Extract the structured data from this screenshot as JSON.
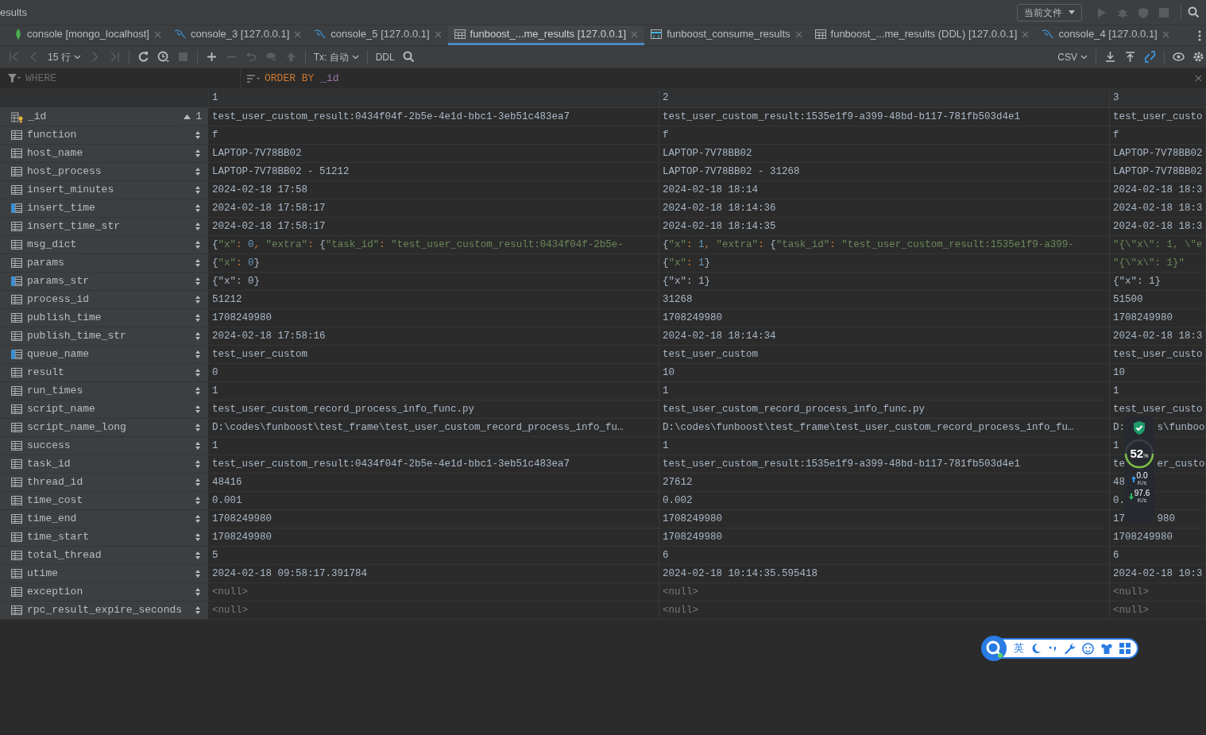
{
  "window": {
    "title": "esults",
    "run_config": "当前文件"
  },
  "tabs": [
    {
      "label": "console [mongo_localhost]",
      "kind": "mongo",
      "selected": false
    },
    {
      "label": "console_3 [127.0.0.1]",
      "kind": "mysql",
      "selected": false
    },
    {
      "label": "console_5 [127.0.0.1]",
      "kind": "mysql",
      "selected": false
    },
    {
      "label": "funboost_...me_results [127.0.0.1]",
      "kind": "table",
      "selected": true
    },
    {
      "label": "funboost_consume_results",
      "kind": "view",
      "selected": false
    },
    {
      "label": "funboost_...me_results (DDL) [127.0.0.1]",
      "kind": "table",
      "selected": false
    },
    {
      "label": "console_4 [127.0.0.1]",
      "kind": "mysql",
      "selected": false
    }
  ],
  "toolbar": {
    "page_size": "15 行",
    "tx": "Tx: 自动",
    "ddl": "DDL",
    "export": "CSV"
  },
  "filter": {
    "where_placeholder": "WHERE",
    "order_keyword": "ORDER BY",
    "order_column": "_id"
  },
  "columns": [
    "1",
    "2",
    "3"
  ],
  "rows": [
    {
      "name": "_id",
      "primary_key": true,
      "indexed": false,
      "sorted": true,
      "sort_order": "1",
      "kind": "text",
      "cells": [
        "test_user_custom_result:0434f04f-2b5e-4e1d-bbc1-3eb51c483ea7",
        "test_user_custom_result:1535e1f9-a399-48bd-b117-781fb503d4e1",
        "test_user_custo"
      ]
    },
    {
      "name": "function",
      "primary_key": false,
      "indexed": false,
      "sorted": false,
      "kind": "text",
      "cells": [
        "f",
        "f",
        "f"
      ]
    },
    {
      "name": "host_name",
      "primary_key": false,
      "indexed": false,
      "sorted": false,
      "kind": "text",
      "cells": [
        "LAPTOP-7V78BB02",
        "LAPTOP-7V78BB02",
        "LAPTOP-7V78BB02"
      ]
    },
    {
      "name": "host_process",
      "primary_key": false,
      "indexed": false,
      "sorted": false,
      "kind": "text",
      "cells": [
        "LAPTOP-7V78BB02 - 51212",
        "LAPTOP-7V78BB02 - 31268",
        "LAPTOP-7V78BB02"
      ]
    },
    {
      "name": "insert_minutes",
      "primary_key": false,
      "indexed": false,
      "sorted": false,
      "kind": "text",
      "cells": [
        "2024-02-18 17:58",
        "2024-02-18 18:14",
        "2024-02-18 18:3"
      ]
    },
    {
      "name": "insert_time",
      "primary_key": false,
      "indexed": true,
      "sorted": false,
      "kind": "text",
      "cells": [
        "2024-02-18 17:58:17",
        "2024-02-18 18:14:36",
        "2024-02-18 18:3"
      ]
    },
    {
      "name": "insert_time_str",
      "primary_key": false,
      "indexed": false,
      "sorted": false,
      "kind": "text",
      "cells": [
        "2024-02-18 17:58:17",
        "2024-02-18 18:14:35",
        "2024-02-18 18:3"
      ]
    },
    {
      "name": "msg_dict",
      "primary_key": false,
      "indexed": false,
      "sorted": false,
      "kind": "json",
      "cells": [
        "{\"x\": 0, \"extra\": {\"task_id\": \"test_user_custom_result:0434f04f-2b5e-",
        "{\"x\": 1, \"extra\": {\"task_id\": \"test_user_custom_result:1535e1f9-a399-",
        "\"{\\\"x\\\": 1, \\\"e"
      ]
    },
    {
      "name": "params",
      "primary_key": false,
      "indexed": false,
      "sorted": false,
      "kind": "json",
      "cells": [
        "{\"x\": 0}",
        "{\"x\": 1}",
        "\"{\\\"x\\\": 1}\""
      ]
    },
    {
      "name": "params_str",
      "primary_key": false,
      "indexed": true,
      "sorted": false,
      "kind": "text",
      "cells": [
        "{\"x\": 0}",
        "{\"x\": 1}",
        "{\"x\": 1}"
      ]
    },
    {
      "name": "process_id",
      "primary_key": false,
      "indexed": false,
      "sorted": false,
      "kind": "text",
      "cells": [
        "51212",
        "31268",
        "51500"
      ]
    },
    {
      "name": "publish_time",
      "primary_key": false,
      "indexed": false,
      "sorted": false,
      "kind": "text",
      "cells": [
        "1708249980",
        "1708249980",
        "1708249980"
      ]
    },
    {
      "name": "publish_time_str",
      "primary_key": false,
      "indexed": false,
      "sorted": false,
      "kind": "text",
      "cells": [
        "2024-02-18 17:58:16",
        "2024-02-18 18:14:34",
        "2024-02-18 18:3"
      ]
    },
    {
      "name": "queue_name",
      "primary_key": false,
      "indexed": true,
      "sorted": false,
      "kind": "text",
      "cells": [
        "test_user_custom",
        "test_user_custom",
        "test_user_custo"
      ]
    },
    {
      "name": "result",
      "primary_key": false,
      "indexed": false,
      "sorted": false,
      "kind": "text",
      "cells": [
        "0",
        "10",
        "10"
      ]
    },
    {
      "name": "run_times",
      "primary_key": false,
      "indexed": false,
      "sorted": false,
      "kind": "text",
      "cells": [
        "1",
        "1",
        "1"
      ]
    },
    {
      "name": "script_name",
      "primary_key": false,
      "indexed": false,
      "sorted": false,
      "kind": "text",
      "cells": [
        "test_user_custom_record_process_info_func.py",
        "test_user_custom_record_process_info_func.py",
        "test_user_custo"
      ]
    },
    {
      "name": "script_name_long",
      "primary_key": false,
      "indexed": false,
      "sorted": false,
      "kind": "text",
      "cells": [
        "D:\\codes\\funboost\\test_frame\\test_user_custom_record_process_info_fu…",
        "D:\\codes\\funboost\\test_frame\\test_user_custom_record_process_info_fu…",
        [
          "D:",
          "s\\funboo"
        ]
      ]
    },
    {
      "name": "success",
      "primary_key": false,
      "indexed": false,
      "sorted": false,
      "kind": "text",
      "cells": [
        "1",
        "1",
        "1"
      ]
    },
    {
      "name": "task_id",
      "primary_key": false,
      "indexed": false,
      "sorted": false,
      "kind": "text",
      "cells": [
        "test_user_custom_result:0434f04f-2b5e-4e1d-bbc1-3eb51c483ea7",
        "test_user_custom_result:1535e1f9-a399-48bd-b117-781fb503d4e1",
        [
          "te",
          "er_custo"
        ]
      ]
    },
    {
      "name": "thread_id",
      "primary_key": false,
      "indexed": false,
      "sorted": false,
      "kind": "text",
      "cells": [
        "48416",
        "27612",
        [
          "48"
        ]
      ]
    },
    {
      "name": "time_cost",
      "primary_key": false,
      "indexed": false,
      "sorted": false,
      "kind": "text",
      "cells": [
        "0.001",
        "0.002",
        [
          "0."
        ]
      ]
    },
    {
      "name": "time_end",
      "primary_key": false,
      "indexed": false,
      "sorted": false,
      "kind": "text",
      "cells": [
        "1708249980",
        "1708249980",
        [
          "17",
          "980"
        ]
      ]
    },
    {
      "name": "time_start",
      "primary_key": false,
      "indexed": false,
      "sorted": false,
      "kind": "text",
      "cells": [
        "1708249980",
        "1708249980",
        "1708249980"
      ]
    },
    {
      "name": "total_thread",
      "primary_key": false,
      "indexed": false,
      "sorted": false,
      "kind": "text",
      "cells": [
        "5",
        "6",
        "6"
      ]
    },
    {
      "name": "utime",
      "primary_key": false,
      "indexed": false,
      "sorted": false,
      "kind": "text",
      "cells": [
        "2024-02-18 09:58:17.391784",
        "2024-02-18 10:14:35.595418",
        "2024-02-18 10:3"
      ]
    },
    {
      "name": "exception",
      "primary_key": false,
      "indexed": false,
      "sorted": false,
      "kind": "null",
      "cells": [
        "<null>",
        "<null>",
        "<null>"
      ]
    },
    {
      "name": "rpc_result_expire_seconds",
      "primary_key": false,
      "indexed": false,
      "sorted": false,
      "kind": "null",
      "cells": [
        "<null>",
        "<null>",
        "<null>"
      ]
    }
  ],
  "monitor": {
    "percent": "52",
    "percent_unit": "%",
    "upload": "0.0",
    "upload_unit": "K/s",
    "download": "97.6",
    "download_unit": "K/s"
  },
  "ime": {
    "mode": "英"
  }
}
